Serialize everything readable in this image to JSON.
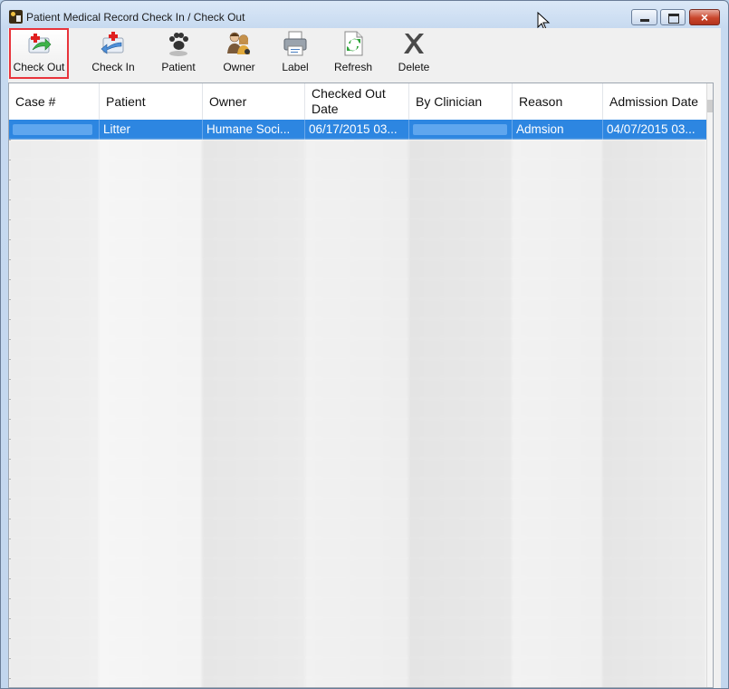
{
  "window": {
    "title": "Patient Medical Record Check In / Check Out",
    "close_label": "×"
  },
  "toolbar": {
    "buttons": [
      {
        "label": "Check Out",
        "icon": "check-out-icon"
      },
      {
        "label": "Check In",
        "icon": "check-in-icon"
      },
      {
        "label": "Patient",
        "icon": "paw-icon"
      },
      {
        "label": "Owner",
        "icon": "owner-icon"
      },
      {
        "label": "Label",
        "icon": "printer-icon"
      },
      {
        "label": "Refresh",
        "icon": "refresh-icon"
      },
      {
        "label": "Delete",
        "icon": "delete-icon"
      }
    ]
  },
  "grid": {
    "columns": [
      "Case #",
      "Patient",
      "Owner",
      "Checked Out Date",
      "By Clinician",
      "Reason",
      "Admission Date"
    ],
    "selected_row": {
      "case": "",
      "patient": "Litter",
      "owner": "Humane Soci...",
      "checked_out_date": "06/17/2015 03...",
      "by_clinician": "",
      "reason": "Admsion",
      "admission_date": "04/07/2015 03..."
    }
  },
  "colors": {
    "selection": "#2d86e1",
    "highlight_border": "#e8333b"
  }
}
